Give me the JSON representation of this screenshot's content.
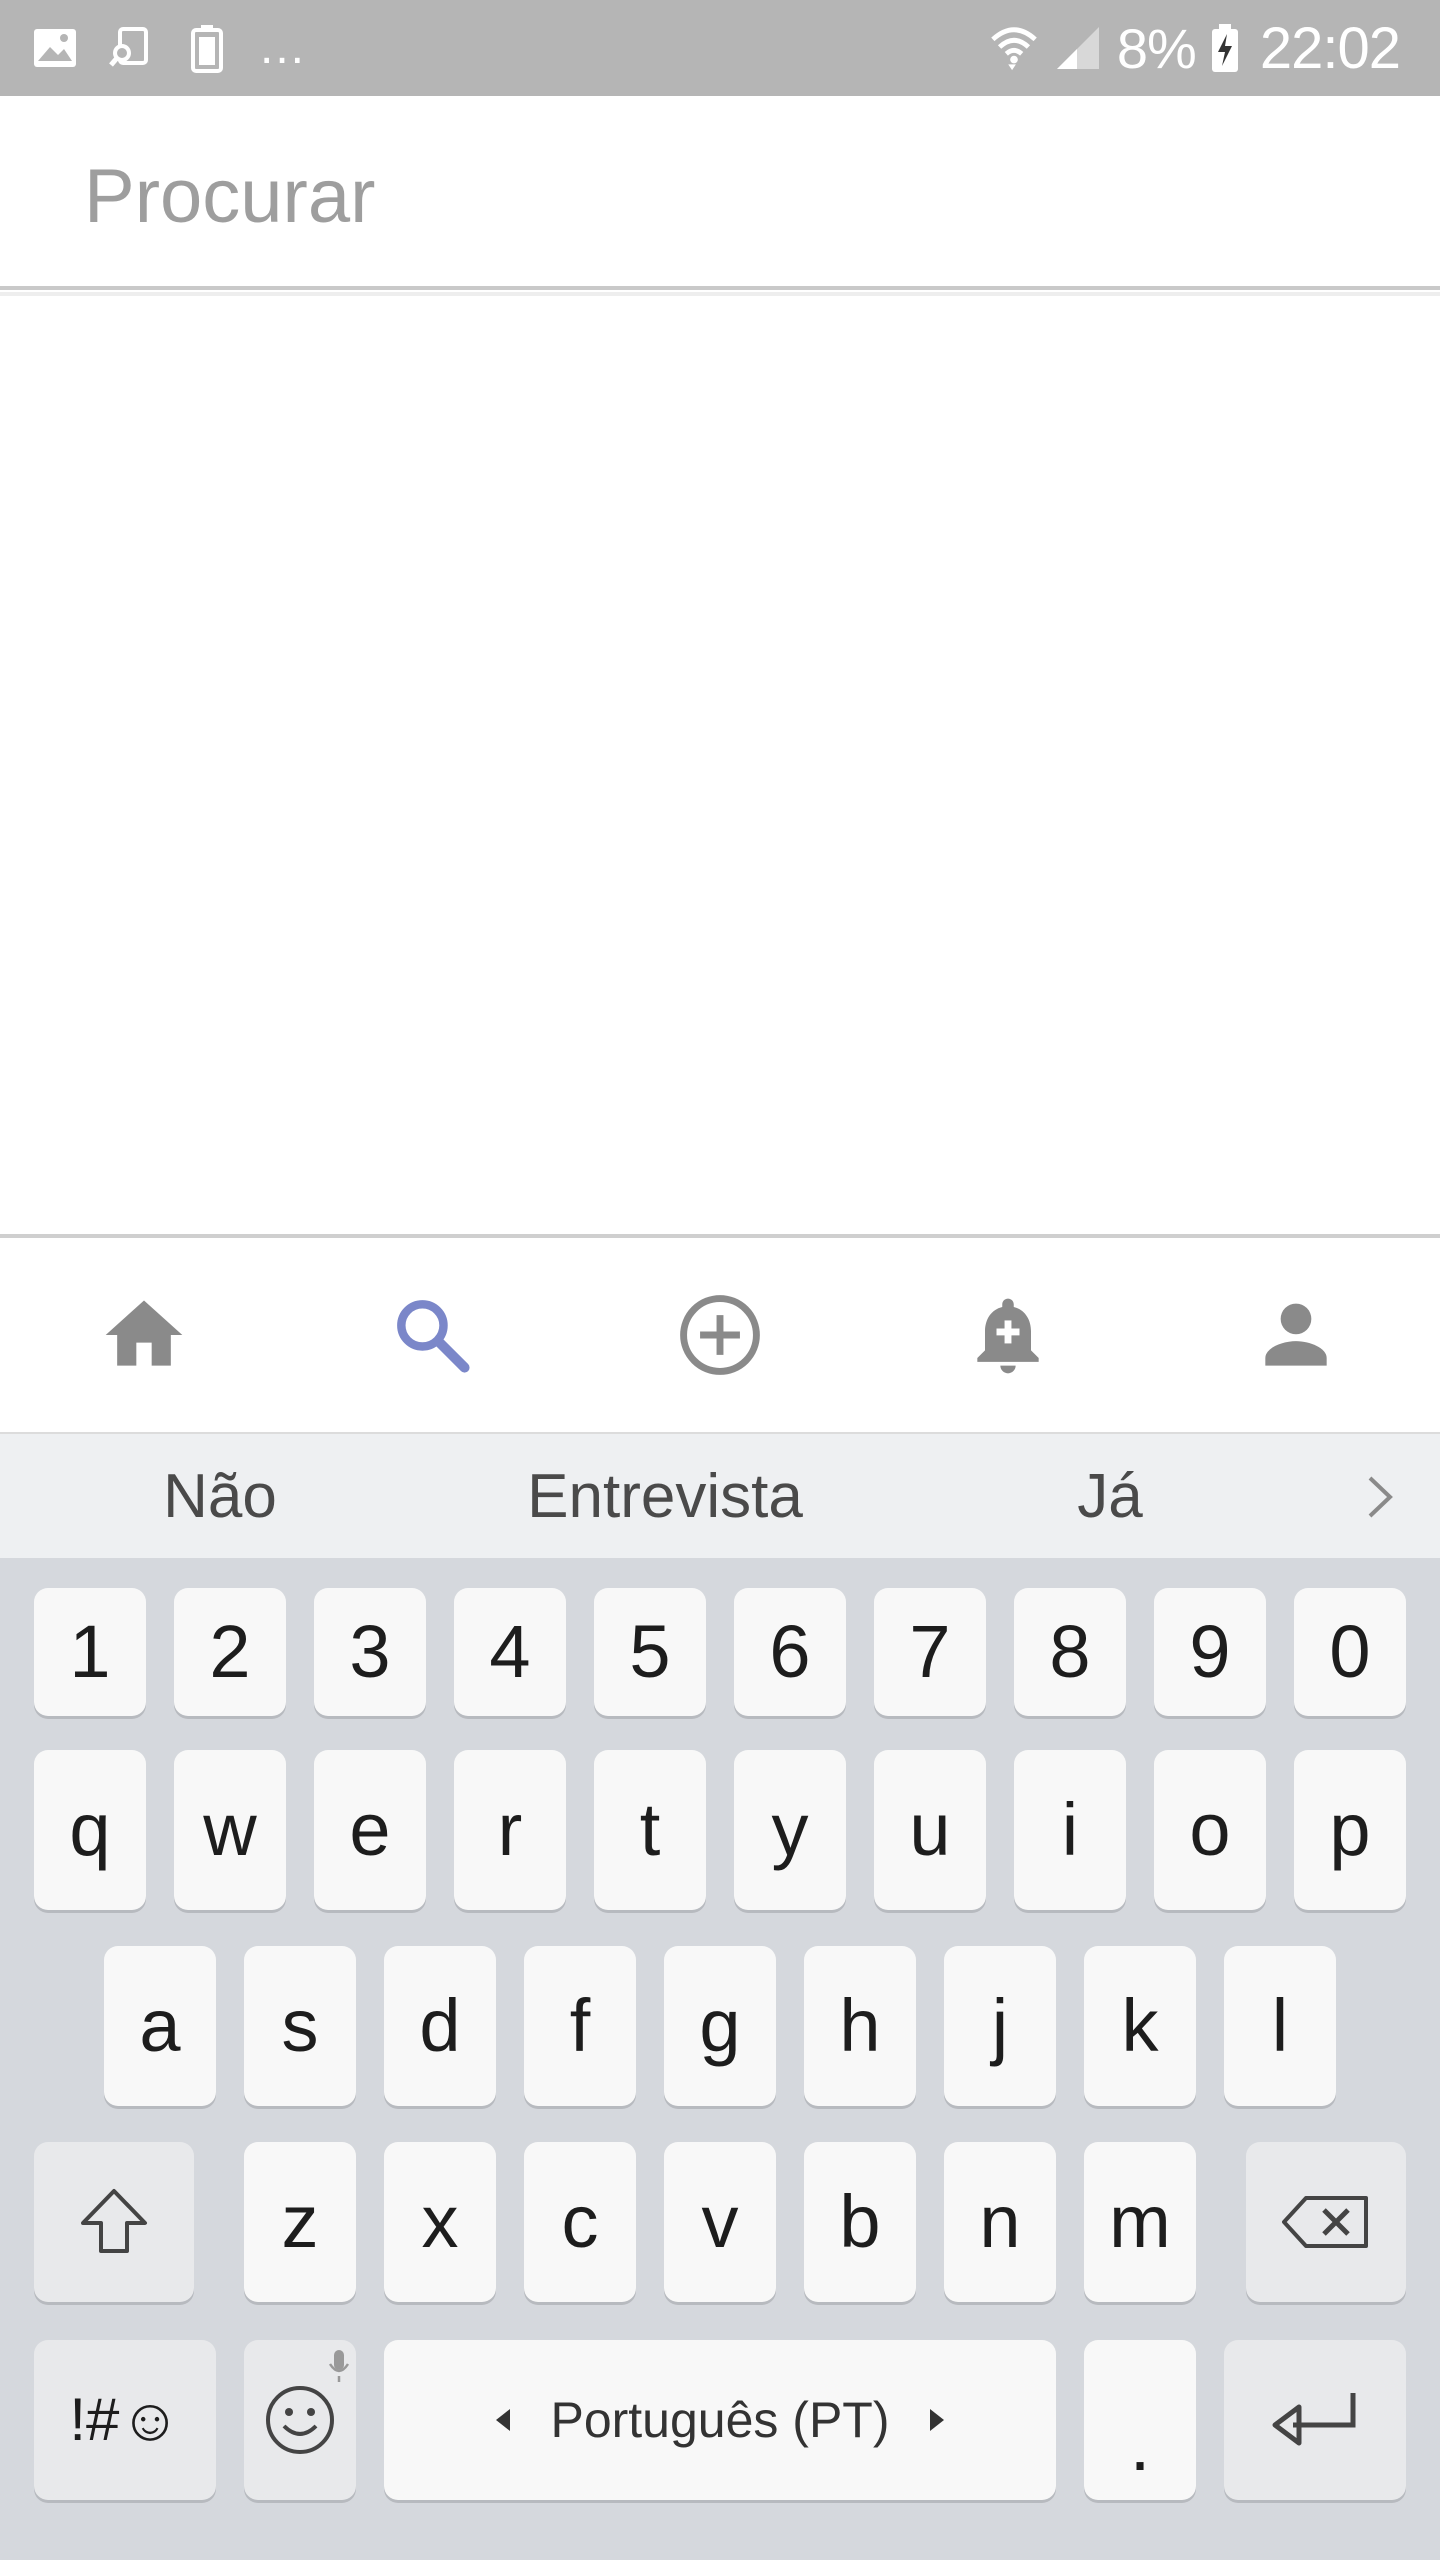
{
  "status_bar": {
    "battery_percent": "8%",
    "time": "22:02",
    "overflow": "..."
  },
  "search": {
    "value": "",
    "placeholder": "Procurar"
  },
  "bottom_nav": {
    "items": [
      {
        "name": "home",
        "icon": "home-icon",
        "active": false
      },
      {
        "name": "search",
        "icon": "search-icon",
        "active": true
      },
      {
        "name": "add",
        "icon": "add-circle-icon",
        "active": false
      },
      {
        "name": "notifications",
        "icon": "bell-plus-icon",
        "active": false
      },
      {
        "name": "profile",
        "icon": "person-icon",
        "active": false
      }
    ],
    "active_color": "#7b87c9",
    "inactive_color": "#8a8a8a"
  },
  "keyboard": {
    "suggestions": [
      "Não",
      "Entrevista",
      "Já"
    ],
    "rows": [
      [
        "1",
        "2",
        "3",
        "4",
        "5",
        "6",
        "7",
        "8",
        "9",
        "0"
      ],
      [
        "q",
        "w",
        "e",
        "r",
        "t",
        "y",
        "u",
        "i",
        "o",
        "p"
      ],
      [
        "a",
        "s",
        "d",
        "f",
        "g",
        "h",
        "j",
        "k",
        "l"
      ],
      [
        "z",
        "x",
        "c",
        "v",
        "b",
        "n",
        "m"
      ]
    ],
    "symbols_label": "!#☺",
    "space_label": "Português (PT)",
    "period_label": "."
  }
}
